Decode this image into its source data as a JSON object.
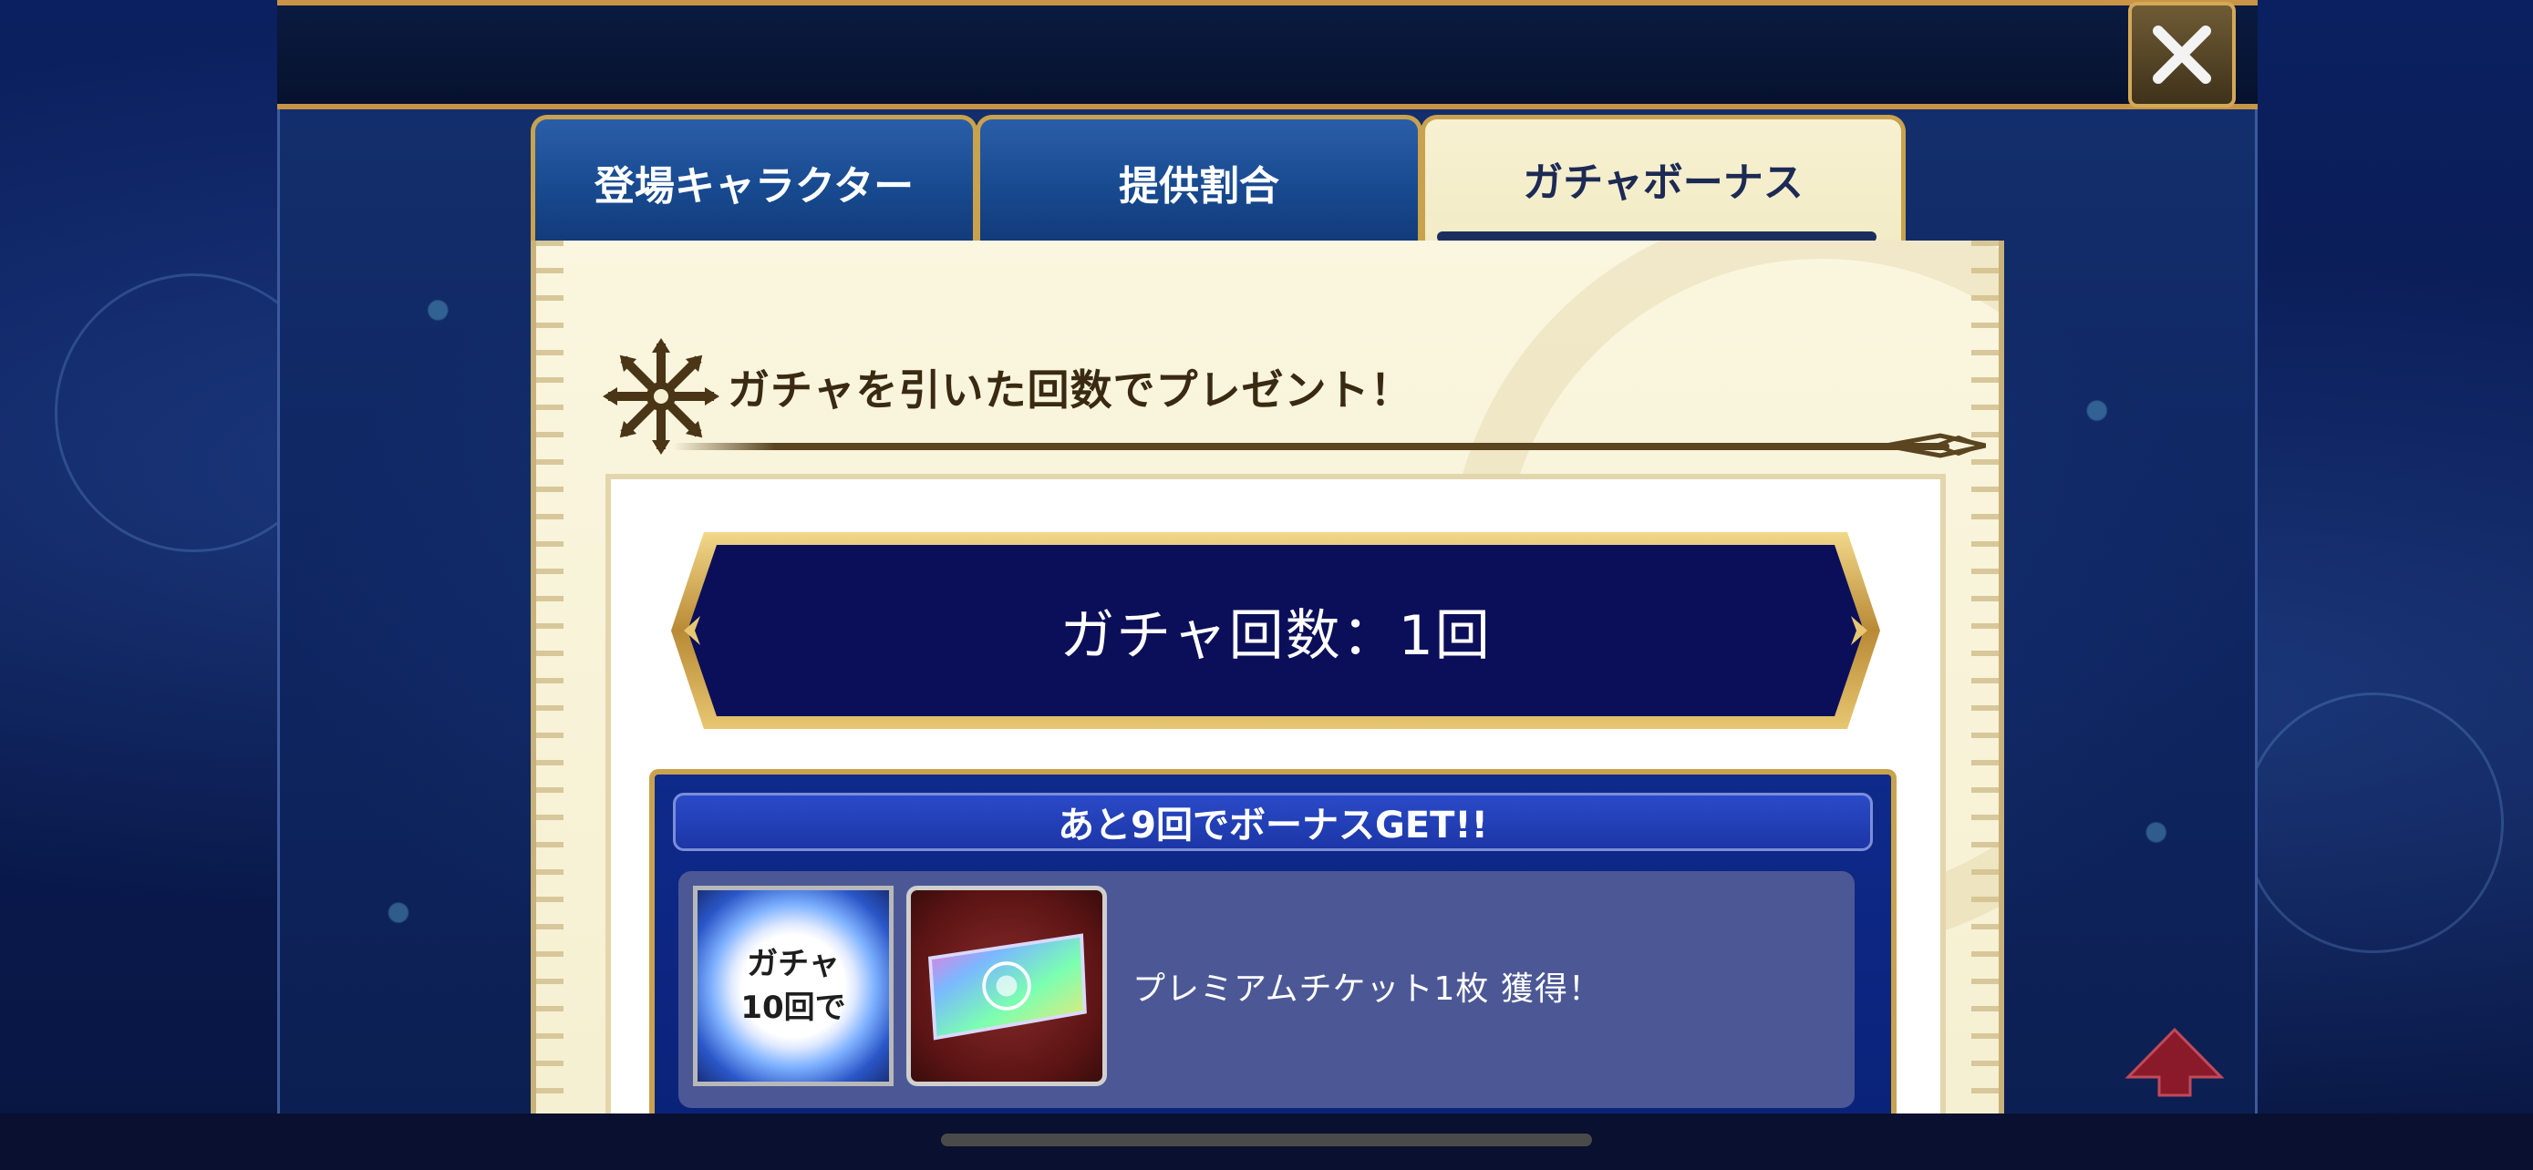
{
  "window": {
    "close_icon": "close-icon"
  },
  "tabs": [
    {
      "label": "登場キャラクター",
      "active": false
    },
    {
      "label": "提供割合",
      "active": false
    },
    {
      "label": "ガチャボーナス",
      "active": true
    }
  ],
  "section": {
    "icon": "snowflake-emblem-icon",
    "title": "ガチャを引いた回数でプレゼント！"
  },
  "gacha_count": {
    "text": "ガチャ回数：1回"
  },
  "bonus": {
    "header": "あと9回でボーナスGET!!",
    "condition_line1": "ガチャ",
    "condition_line2": "10回で",
    "reward_icon": "premium-ticket-icon",
    "reward_text": "プレミアムチケット1枚 獲得！"
  },
  "colors": {
    "gold": "#c9a24e",
    "navy": "#0a1b52",
    "panel": "#f6f0d2",
    "reward_row": "#4c5895"
  }
}
